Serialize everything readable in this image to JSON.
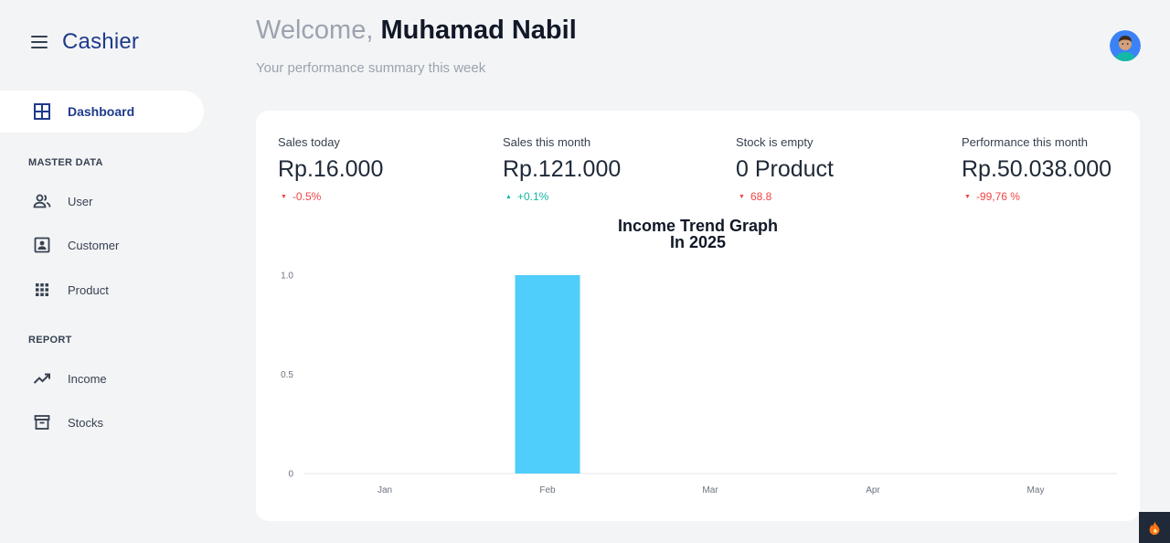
{
  "app": {
    "title": "Cashier"
  },
  "sidebar": {
    "active": {
      "label": "Dashboard",
      "icon": "dashboard-grid-icon"
    },
    "sections": [
      {
        "label": "MASTER DATA",
        "items": [
          {
            "label": "User",
            "icon": "users-icon"
          },
          {
            "label": "Customer",
            "icon": "contact-card-icon"
          },
          {
            "label": "Product",
            "icon": "apps-grid-icon"
          }
        ]
      },
      {
        "label": "REPORT",
        "items": [
          {
            "label": "Income",
            "icon": "trending-up-icon"
          },
          {
            "label": "Stocks",
            "icon": "archive-icon"
          }
        ]
      }
    ]
  },
  "header": {
    "welcome_prefix": "Welcome,",
    "user_name": "Muhamad Nabil",
    "subtitle": "Your performance summary this week"
  },
  "stats": [
    {
      "label": "Sales today",
      "value": "Rp.16.000",
      "change": "-0.5%",
      "direction": "down"
    },
    {
      "label": "Sales this month",
      "value": "Rp.121.000",
      "change": "+0.1%",
      "direction": "up"
    },
    {
      "label": "Stock is empty",
      "value": "0 Product",
      "change": "68.8",
      "direction": "down"
    },
    {
      "label": "Performance this month",
      "value": "Rp.50.038.000",
      "change": "-99,76 %",
      "direction": "down"
    }
  ],
  "colors": {
    "accent": "#1e3a8a",
    "bar": "#4fcdfb",
    "down": "#ef4444",
    "up": "#14b8a6"
  },
  "chart_data": {
    "type": "bar",
    "title": "Income Trend Graph",
    "subtitle": "In 2025",
    "categories": [
      "Jan",
      "Feb",
      "Mar",
      "Apr",
      "May"
    ],
    "values": [
      0,
      1,
      0,
      0,
      0
    ],
    "yticks": [
      "0",
      "0.5",
      "1.0"
    ],
    "ylim": [
      0,
      1
    ],
    "xlabel": "",
    "ylabel": "",
    "grid": false,
    "legend": "none"
  }
}
